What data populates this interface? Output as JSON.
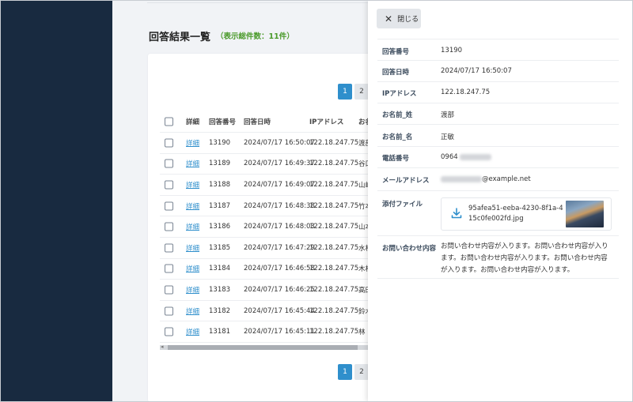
{
  "page": {
    "title": "回答結果一覧",
    "count": "（表示総件数：11件）"
  },
  "pagination": {
    "pages": [
      "1",
      "2"
    ],
    "active": "1"
  },
  "table": {
    "headers": {
      "detail": "詳細",
      "id": "回答番号",
      "date": "回答日時",
      "ip": "IPアドレス",
      "name": "お名"
    },
    "rows": [
      {
        "detail": "詳細",
        "id": "13190",
        "date": "2024/07/17 16:50:07",
        "ip": "122.18.247.75",
        "name": "渡部"
      },
      {
        "detail": "詳細",
        "id": "13189",
        "date": "2024/07/17 16:49:37",
        "ip": "122.18.247.75",
        "name": "谷口"
      },
      {
        "detail": "詳細",
        "id": "13188",
        "date": "2024/07/17 16:49:07",
        "ip": "122.18.247.75",
        "name": "山崎"
      },
      {
        "detail": "詳細",
        "id": "13187",
        "date": "2024/07/17 16:48:38",
        "ip": "122.18.247.75",
        "name": "竹本"
      },
      {
        "detail": "詳細",
        "id": "13186",
        "date": "2024/07/17 16:48:03",
        "ip": "122.18.247.75",
        "name": "山本"
      },
      {
        "detail": "詳細",
        "id": "13185",
        "date": "2024/07/17 16:47:29",
        "ip": "122.18.247.75",
        "name": "水村"
      },
      {
        "detail": "詳細",
        "id": "13184",
        "date": "2024/07/17 16:46:58",
        "ip": "122.18.247.75",
        "name": "木村"
      },
      {
        "detail": "詳細",
        "id": "13183",
        "date": "2024/07/17 16:46:25",
        "ip": "122.18.247.75",
        "name": "高田"
      },
      {
        "detail": "詳細",
        "id": "13182",
        "date": "2024/07/17 16:45:44",
        "ip": "122.18.247.75",
        "name": "鈴木"
      },
      {
        "detail": "詳細",
        "id": "13181",
        "date": "2024/07/17 16:45:11",
        "ip": "122.18.247.75",
        "name": "林"
      }
    ]
  },
  "panel": {
    "close_label": "閉じる",
    "fields": {
      "answer_id": {
        "label": "回答番号",
        "value": "13190"
      },
      "answer_date": {
        "label": "回答日時",
        "value": "2024/07/17 16:50:07"
      },
      "ip": {
        "label": "IPアドレス",
        "value": "122.18.247.75"
      },
      "last_name": {
        "label": "お名前_姓",
        "value": "渡部"
      },
      "first_name": {
        "label": "お名前_名",
        "value": "正敏"
      },
      "phone": {
        "label": "電話番号",
        "value": "0964"
      },
      "email": {
        "label": "メールアドレス",
        "value": "@example.net"
      },
      "attachment": {
        "label": "添付ファイル",
        "value": "95afea51-eeba-4230-8f1a-415c0fe002fd.jpg"
      },
      "inquiry": {
        "label": "お問い合わせ内容",
        "value": "お問い合わせ内容が入ります。お問い合わせ内容が入ります。お問い合わせ内容が入ります。お問い合わせ内容が入ります。お問い合わせ内容が入ります。"
      }
    }
  },
  "colors": {
    "sidebar": "#182a40",
    "accent": "#2f8fcc",
    "count": "#4a9a2a"
  }
}
